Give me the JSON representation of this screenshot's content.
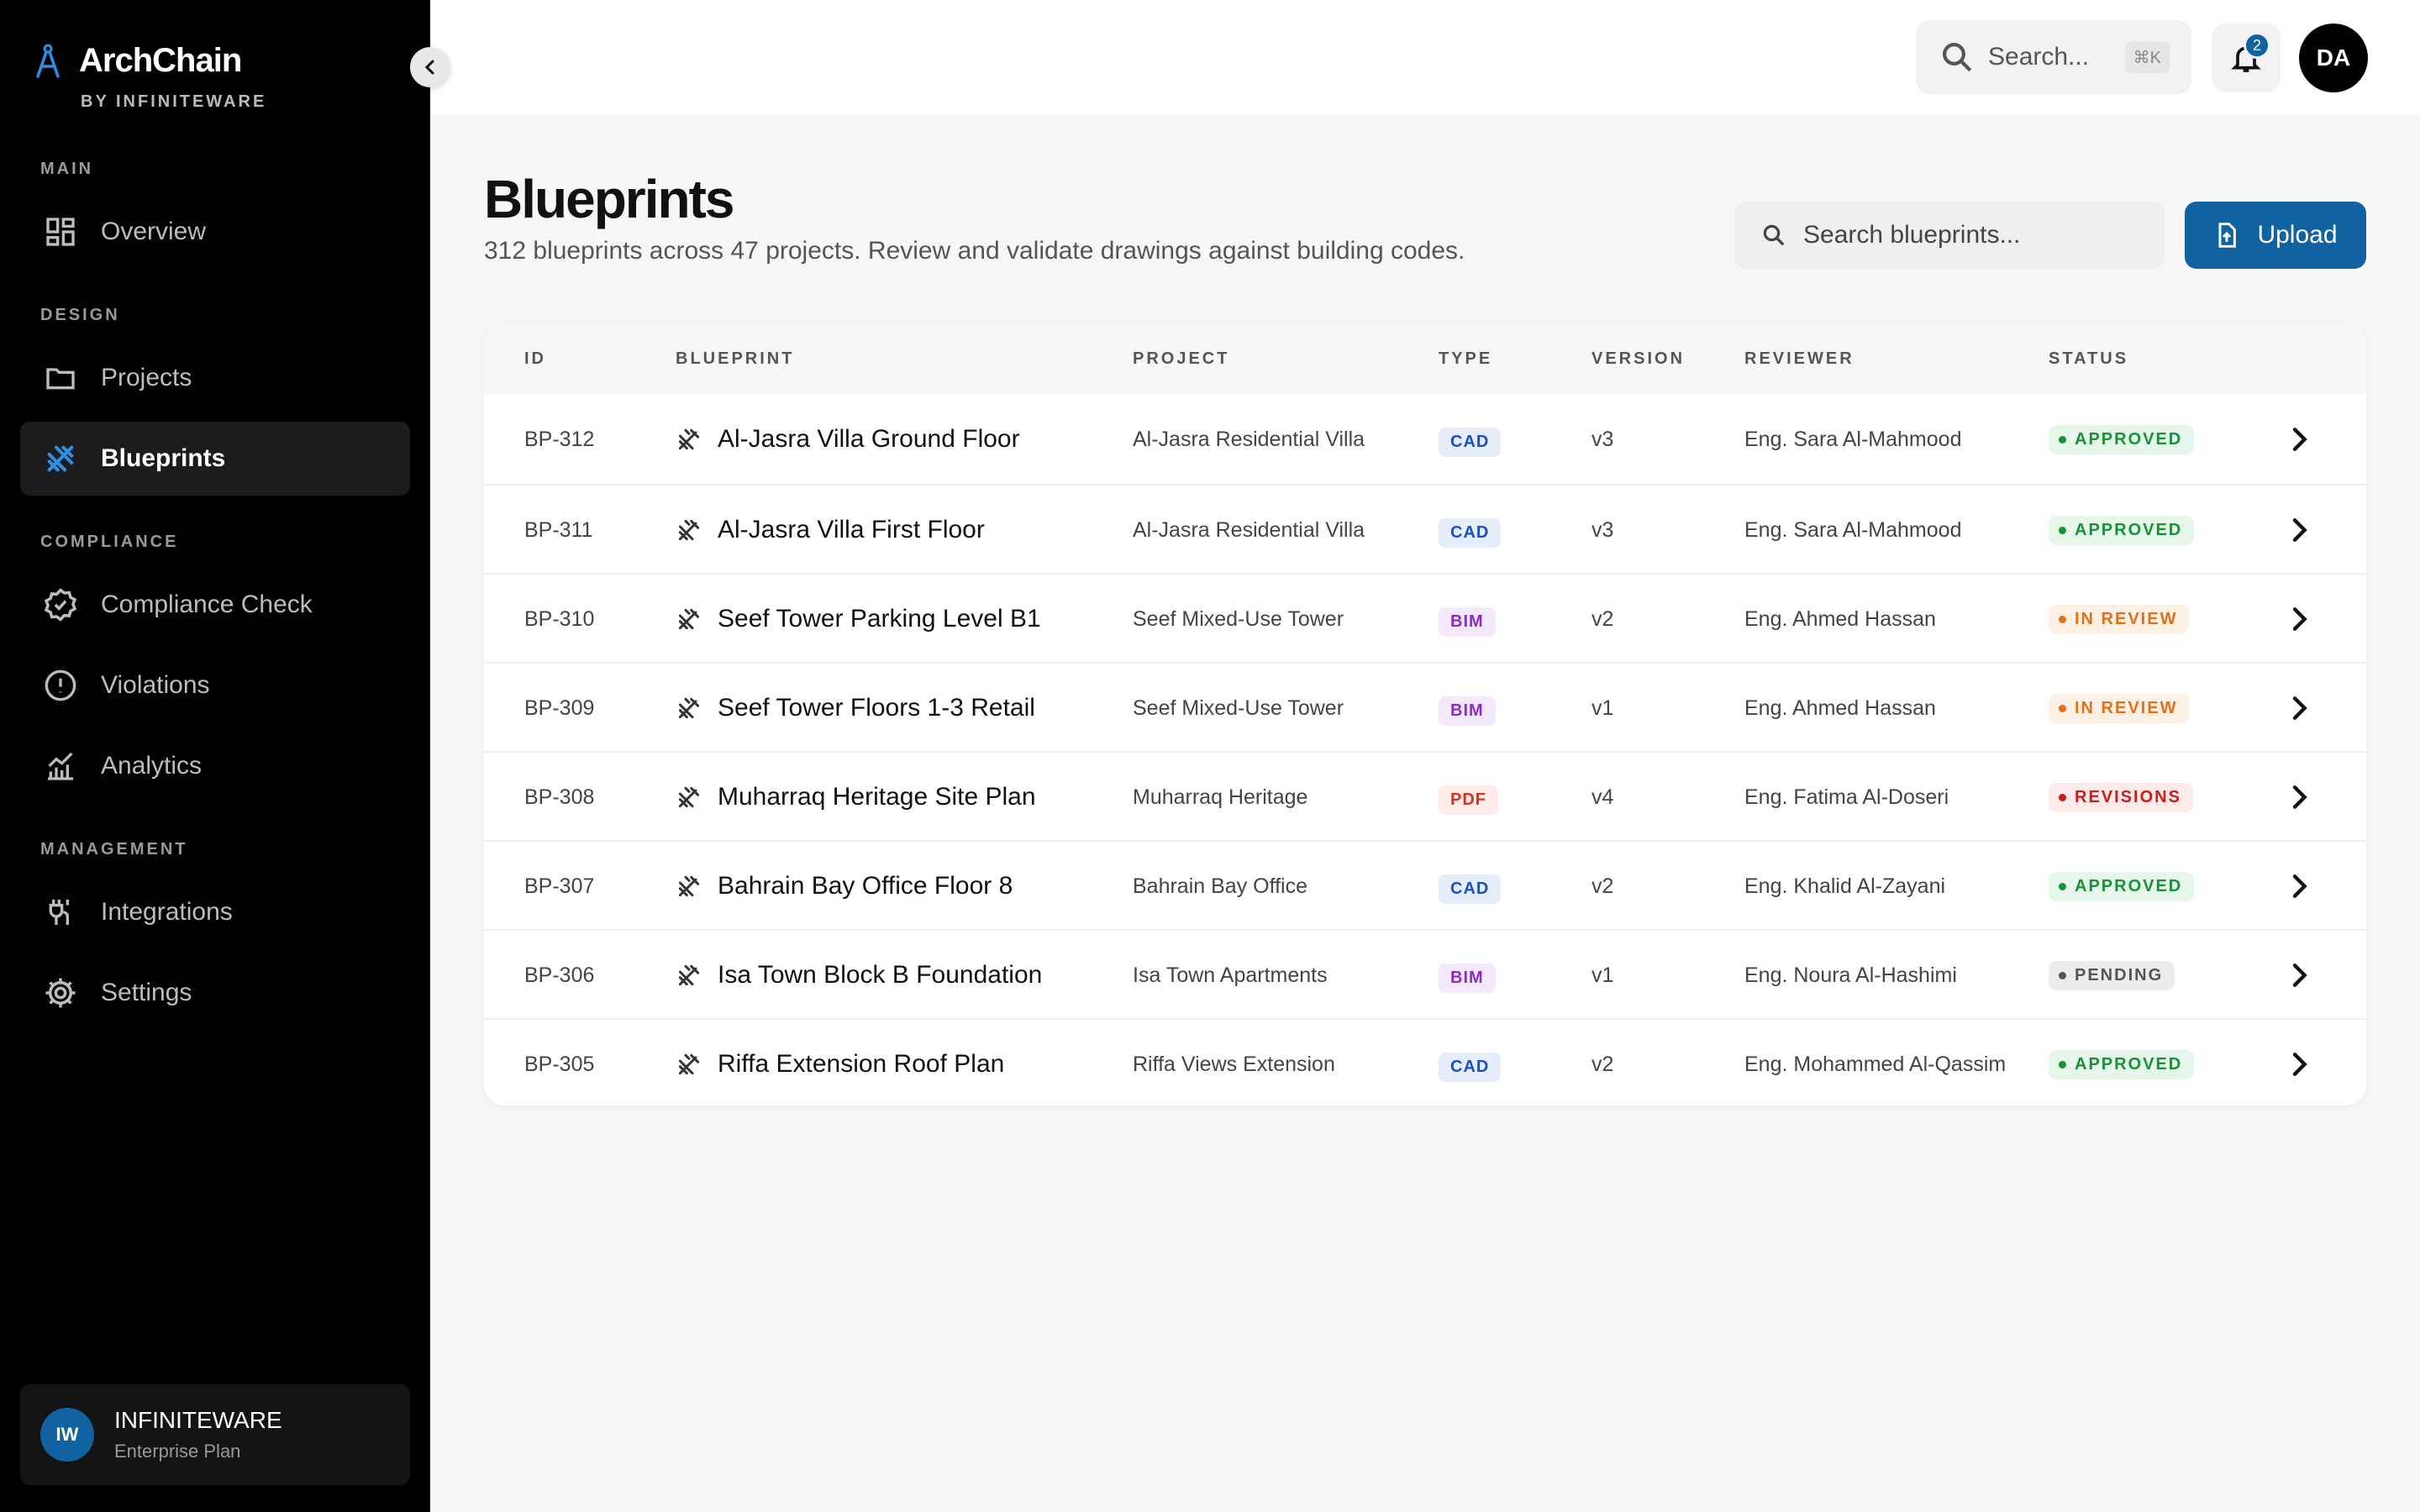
{
  "brand": {
    "name": "ArchChain",
    "sub": "BY INFINITEWARE"
  },
  "sidebar": {
    "sections": [
      {
        "label": "MAIN"
      },
      {
        "label": "DESIGN"
      },
      {
        "label": "COMPLIANCE"
      },
      {
        "label": "MANAGEMENT"
      }
    ],
    "items": [
      {
        "label": "Overview",
        "icon": "grid-icon"
      },
      {
        "label": "Projects",
        "icon": "folder-icon"
      },
      {
        "label": "Blueprints",
        "icon": "blueprint-icon",
        "active": true
      },
      {
        "label": "Compliance Check",
        "icon": "badge-check-icon"
      },
      {
        "label": "Violations",
        "icon": "alert-circle-icon"
      },
      {
        "label": "Analytics",
        "icon": "chart-icon"
      },
      {
        "label": "Integrations",
        "icon": "plug-icon"
      },
      {
        "label": "Settings",
        "icon": "gear-icon"
      }
    ],
    "org": {
      "initials": "IW",
      "name": "INFINITEWARE",
      "plan": "Enterprise Plan"
    }
  },
  "topbar": {
    "search_placeholder": "Search...",
    "shortcut": "⌘K",
    "notifications": "2",
    "user_initials": "DA"
  },
  "page": {
    "title": "Blueprints",
    "subtitle": "312 blueprints across 47 projects. Review and validate drawings against building codes.",
    "search_placeholder": "Search blueprints...",
    "upload_label": "Upload"
  },
  "table": {
    "headers": [
      "ID",
      "BLUEPRINT",
      "PROJECT",
      "TYPE",
      "VERSION",
      "REVIEWER",
      "STATUS"
    ],
    "rows": [
      {
        "id": "BP-312",
        "name": "Al-Jasra Villa Ground Floor",
        "project": "Al-Jasra Residential Villa",
        "type": "CAD",
        "version": "v3",
        "reviewer": "Eng. Sara Al-Mahmood",
        "status": "APPROVED"
      },
      {
        "id": "BP-311",
        "name": "Al-Jasra Villa First Floor",
        "project": "Al-Jasra Residential Villa",
        "type": "CAD",
        "version": "v3",
        "reviewer": "Eng. Sara Al-Mahmood",
        "status": "APPROVED"
      },
      {
        "id": "BP-310",
        "name": "Seef Tower Parking Level B1",
        "project": "Seef Mixed-Use Tower",
        "type": "BIM",
        "version": "v2",
        "reviewer": "Eng. Ahmed Hassan",
        "status": "IN REVIEW"
      },
      {
        "id": "BP-309",
        "name": "Seef Tower Floors 1-3 Retail",
        "project": "Seef Mixed-Use Tower",
        "type": "BIM",
        "version": "v1",
        "reviewer": "Eng. Ahmed Hassan",
        "status": "IN REVIEW"
      },
      {
        "id": "BP-308",
        "name": "Muharraq Heritage Site Plan",
        "project": "Muharraq Heritage",
        "type": "PDF",
        "version": "v4",
        "reviewer": "Eng. Fatima Al-Doseri",
        "status": "REVISIONS"
      },
      {
        "id": "BP-307",
        "name": "Bahrain Bay Office Floor 8",
        "project": "Bahrain Bay Office",
        "type": "CAD",
        "version": "v2",
        "reviewer": "Eng. Khalid Al-Zayani",
        "status": "APPROVED"
      },
      {
        "id": "BP-306",
        "name": "Isa Town Block B Foundation",
        "project": "Isa Town Apartments",
        "type": "BIM",
        "version": "v1",
        "reviewer": "Eng. Noura Al-Hashimi",
        "status": "PENDING"
      },
      {
        "id": "BP-305",
        "name": "Riffa Extension Roof Plan",
        "project": "Riffa Views Extension",
        "type": "CAD",
        "version": "v2",
        "reviewer": "Eng. Mohammed Al-Qassim",
        "status": "APPROVED"
      }
    ]
  },
  "colors": {
    "accent": "#1063a0",
    "type": {
      "CAD": {
        "fg": "#1d4fbf",
        "bg": "#e6eefc"
      },
      "BIM": {
        "fg": "#8a2bc9",
        "bg": "#f4e9fc"
      },
      "PDF": {
        "fg": "#d6321f",
        "bg": "#fdecea"
      }
    },
    "status": {
      "APPROVED": {
        "fg": "#17913a",
        "bg": "#e6f6ea"
      },
      "IN REVIEW": {
        "fg": "#e0701a",
        "bg": "#fdf1e6"
      },
      "REVISIONS": {
        "fg": "#c7201a",
        "bg": "#fdeaea"
      },
      "PENDING": {
        "fg": "#555555",
        "bg": "#ececee"
      }
    }
  }
}
